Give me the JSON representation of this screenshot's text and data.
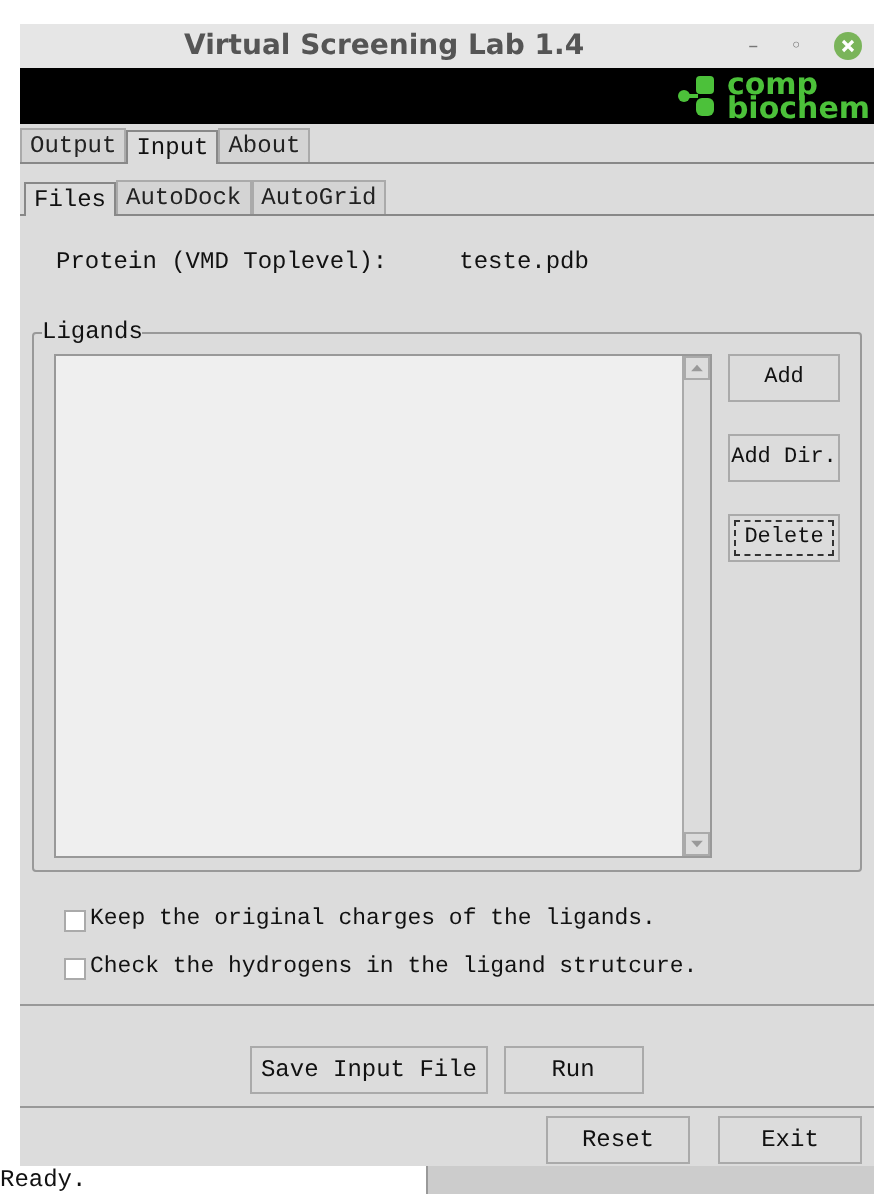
{
  "window": {
    "title": "Virtual Screening Lab 1.4",
    "controls": [
      "–",
      "◦"
    ]
  },
  "logo": {
    "line1": "comp",
    "line2": "biochem"
  },
  "tabs": [
    {
      "label": "Output",
      "selected": false
    },
    {
      "label": "Input",
      "selected": true
    },
    {
      "label": "About",
      "selected": false
    }
  ],
  "subtabs": [
    {
      "label": "Files",
      "selected": true
    },
    {
      "label": "AutoDock",
      "selected": false
    },
    {
      "label": "AutoGrid",
      "selected": false
    }
  ],
  "protein": {
    "label": "Protein (VMD Toplevel):",
    "value": "teste.pdb"
  },
  "ligands": {
    "title": "Ligands",
    "buttons": [
      {
        "label": "Add",
        "focused": false
      },
      {
        "label": "Add Dir.",
        "focused": false
      },
      {
        "label": "Delete",
        "focused": true
      }
    ]
  },
  "options": [
    {
      "label": "Keep the original charges of the ligands.",
      "checked": false
    },
    {
      "label": "Check the hydrogens in the ligand strutcure.",
      "checked": false
    }
  ],
  "actions": [
    "Save Input File",
    "Run"
  ],
  "footer_buttons": [
    "Reset",
    "Exit"
  ],
  "status_bar": "Ready."
}
